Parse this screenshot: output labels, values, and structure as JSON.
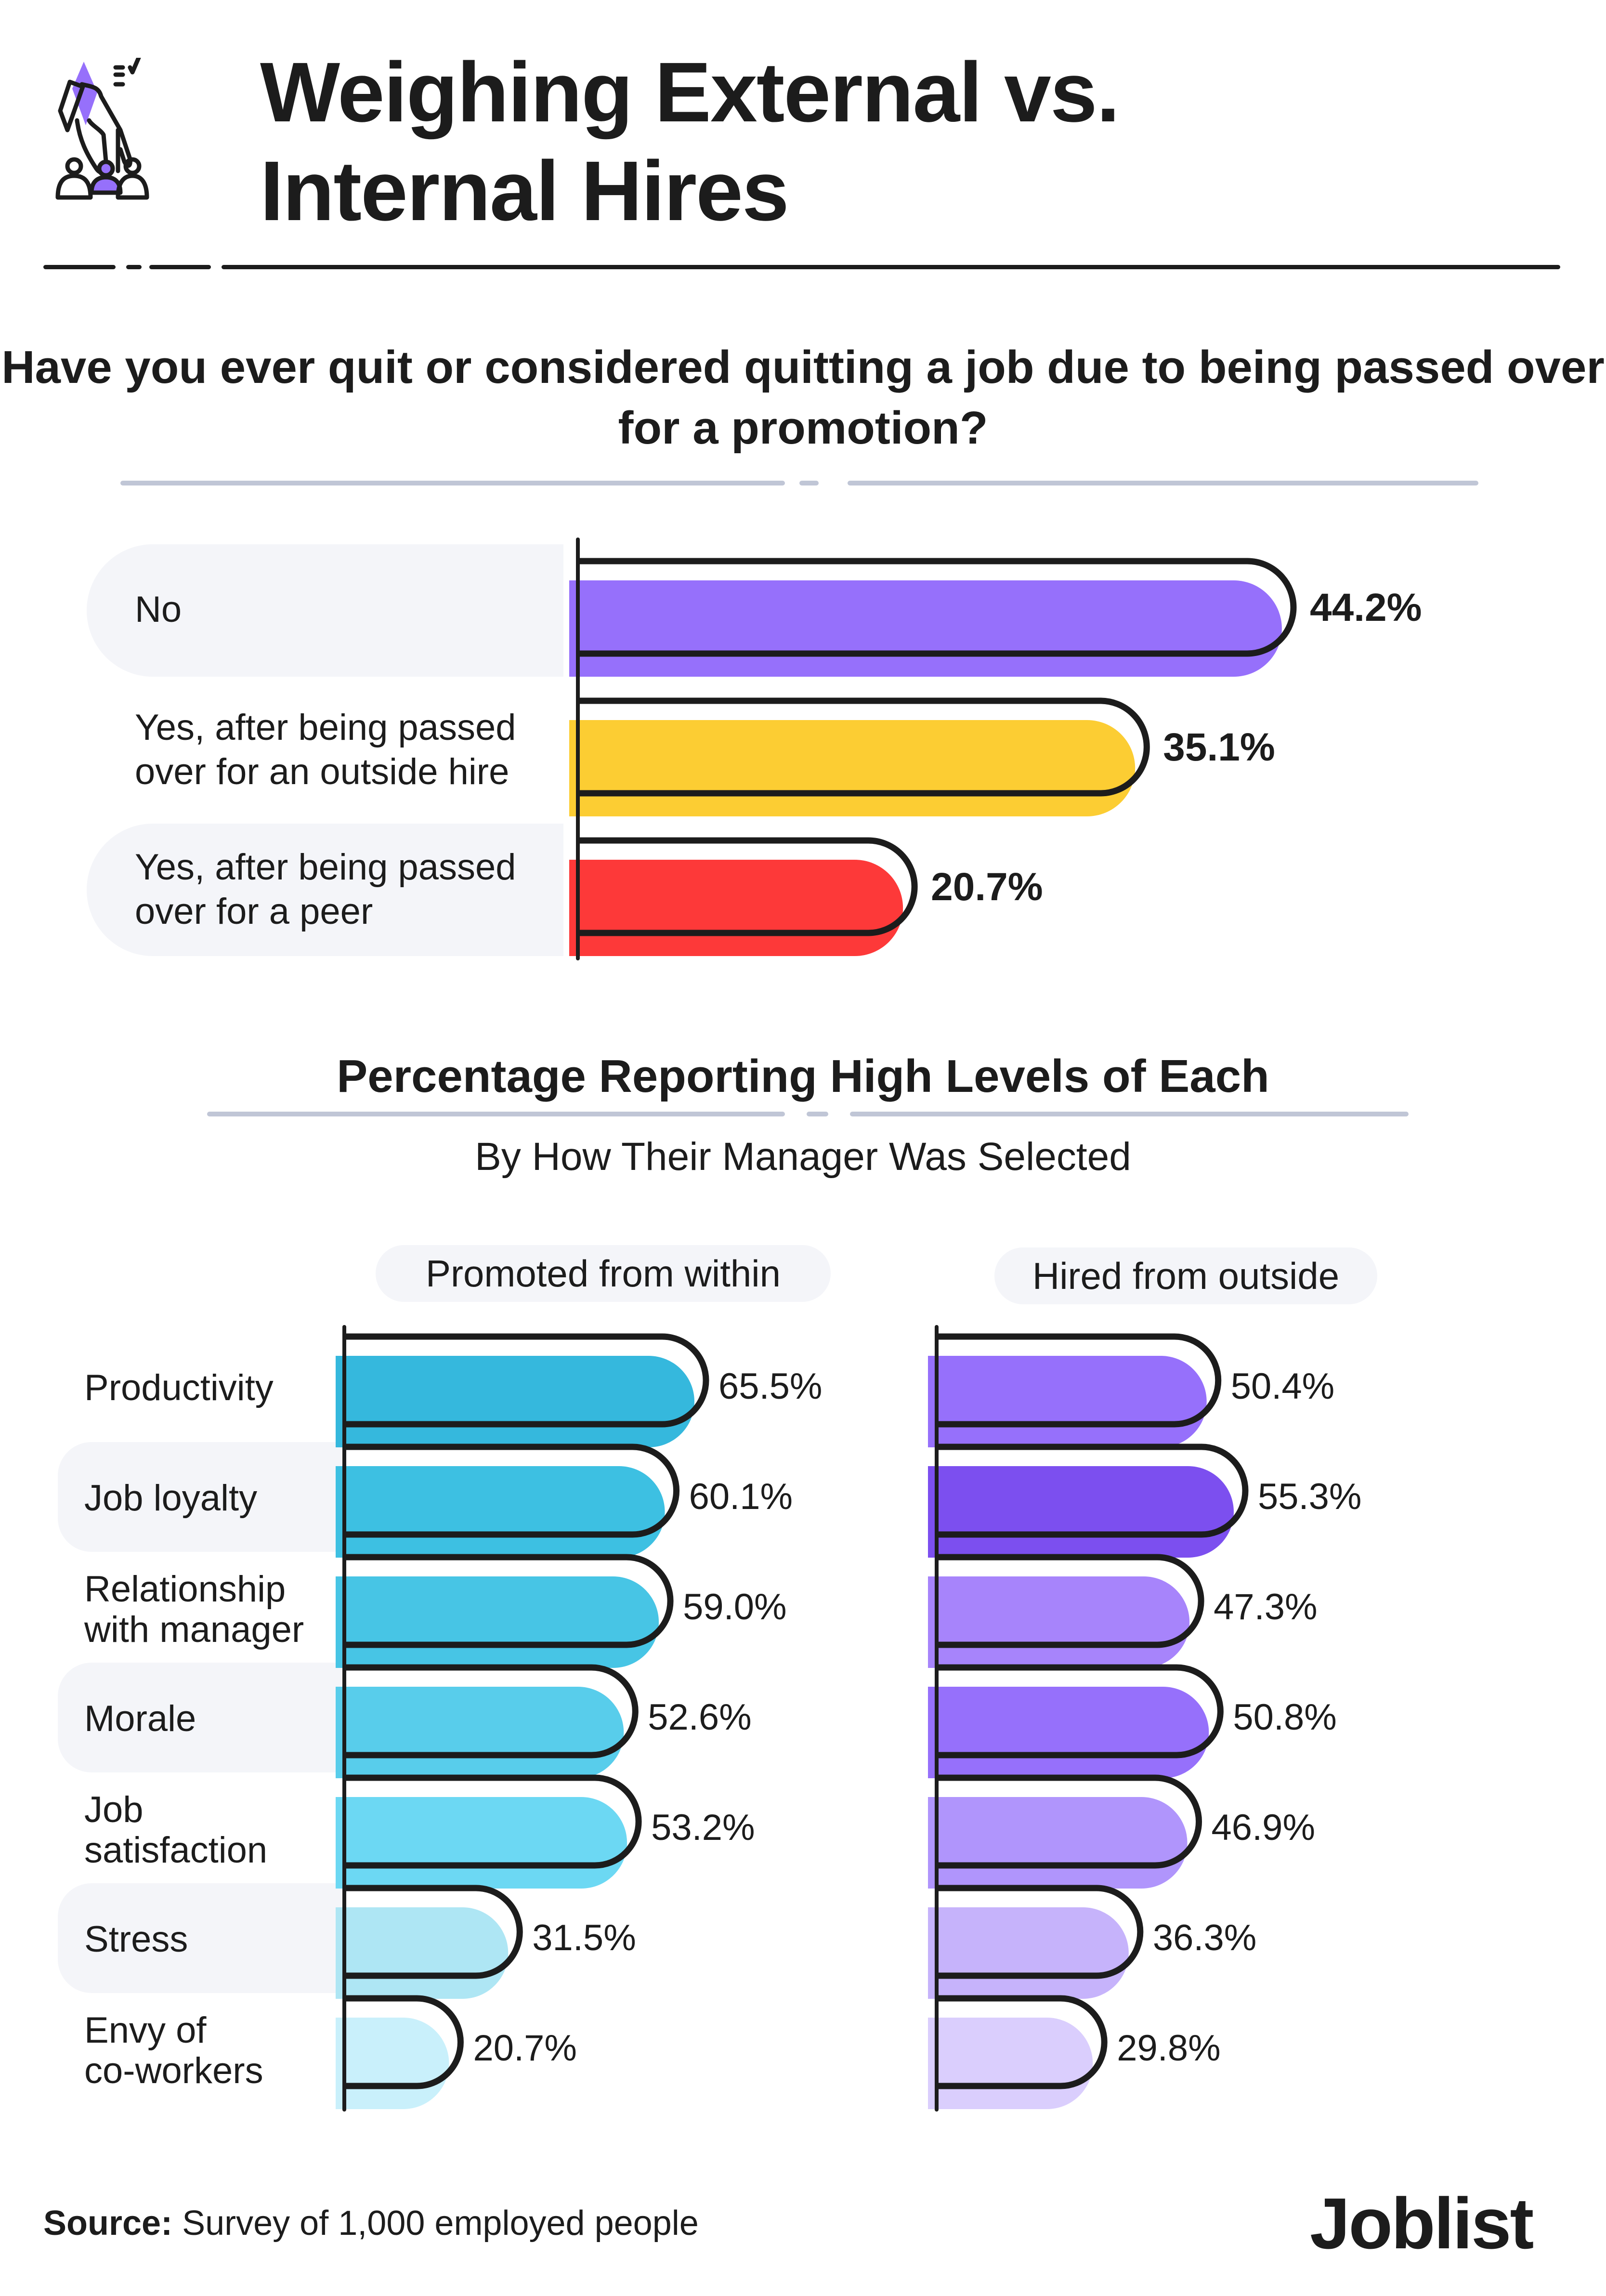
{
  "header": {
    "title_lines": [
      "Weighing External vs.",
      "Internal Hires"
    ],
    "icon": "hand-selecting-candidate-icon"
  },
  "colors": {
    "accent_purple": "#9670fb",
    "yellow": "#fccd33",
    "red": "#fd3939",
    "band_bg": "#f4f5f9",
    "divider": "#c0c6d6",
    "ink": "#1c1c1c"
  },
  "chart_data": [
    {
      "type": "bar",
      "orientation": "horizontal",
      "title": "Have you ever quit or considered quitting a job due to being passed over for a promotion?",
      "categories": [
        "No",
        "Yes, after being passed over for an outside hire",
        "Yes, after being passed over for a peer"
      ],
      "category_lines": [
        [
          "No"
        ],
        [
          "Yes, after being passed",
          "over for an outside hire"
        ],
        [
          "Yes, after being passed",
          "over for a peer"
        ]
      ],
      "values": [
        44.2,
        35.1,
        20.7
      ],
      "labels": [
        "44.2%",
        "35.1%",
        "20.7%"
      ],
      "bar_colors": [
        "#9670fb",
        "#fccd33",
        "#fd3939"
      ],
      "unit": "%",
      "xlim": [
        0,
        44.2
      ],
      "grid": false,
      "legend": "none"
    },
    {
      "type": "bar",
      "orientation": "horizontal",
      "title": "Percentage Reporting High Levels of Each",
      "subtitle": "By How Their Manager Was Selected",
      "categories": [
        "Productivity",
        "Job loyalty",
        "Relationship with manager",
        "Morale",
        "Job satisfaction",
        "Stress",
        "Envy of co-workers"
      ],
      "category_lines": [
        [
          "Productivity"
        ],
        [
          "Job loyalty"
        ],
        [
          "Relationship",
          "with manager"
        ],
        [
          "Morale"
        ],
        [
          "Job",
          "satisfaction"
        ],
        [
          "Stress"
        ],
        [
          "Envy of",
          "co-workers"
        ]
      ],
      "series": [
        {
          "name": "Promoted from within",
          "values": [
            65.5,
            60.1,
            59.0,
            52.6,
            53.2,
            31.5,
            20.7
          ],
          "labels": [
            "65.5%",
            "60.1%",
            "59.0%",
            "52.6%",
            "53.2%",
            "31.5%",
            "20.7%"
          ],
          "bar_colors": [
            "#35b8dd",
            "#3dc0e2",
            "#47c5e5",
            "#58cdeb",
            "#6cd8f3",
            "#aee6f4",
            "#c9f0fb"
          ]
        },
        {
          "name": "Hired from outside",
          "values": [
            50.4,
            55.3,
            47.3,
            50.8,
            46.9,
            36.3,
            29.8
          ],
          "labels": [
            "50.4%",
            "55.3%",
            "47.3%",
            "50.8%",
            "46.9%",
            "36.3%",
            "29.8%"
          ],
          "bar_colors": [
            "#9670fb",
            "#7c4fef",
            "#a784fb",
            "#9670fb",
            "#b095fc",
            "#c6b3fb",
            "#dacefd"
          ]
        }
      ],
      "unit": "%",
      "grid": false,
      "legend": "top (pill labels above each panel)"
    }
  ],
  "footer": {
    "source_label": "Source:",
    "source_text": " Survey of 1,000 employed people",
    "brand": "Joblist"
  }
}
